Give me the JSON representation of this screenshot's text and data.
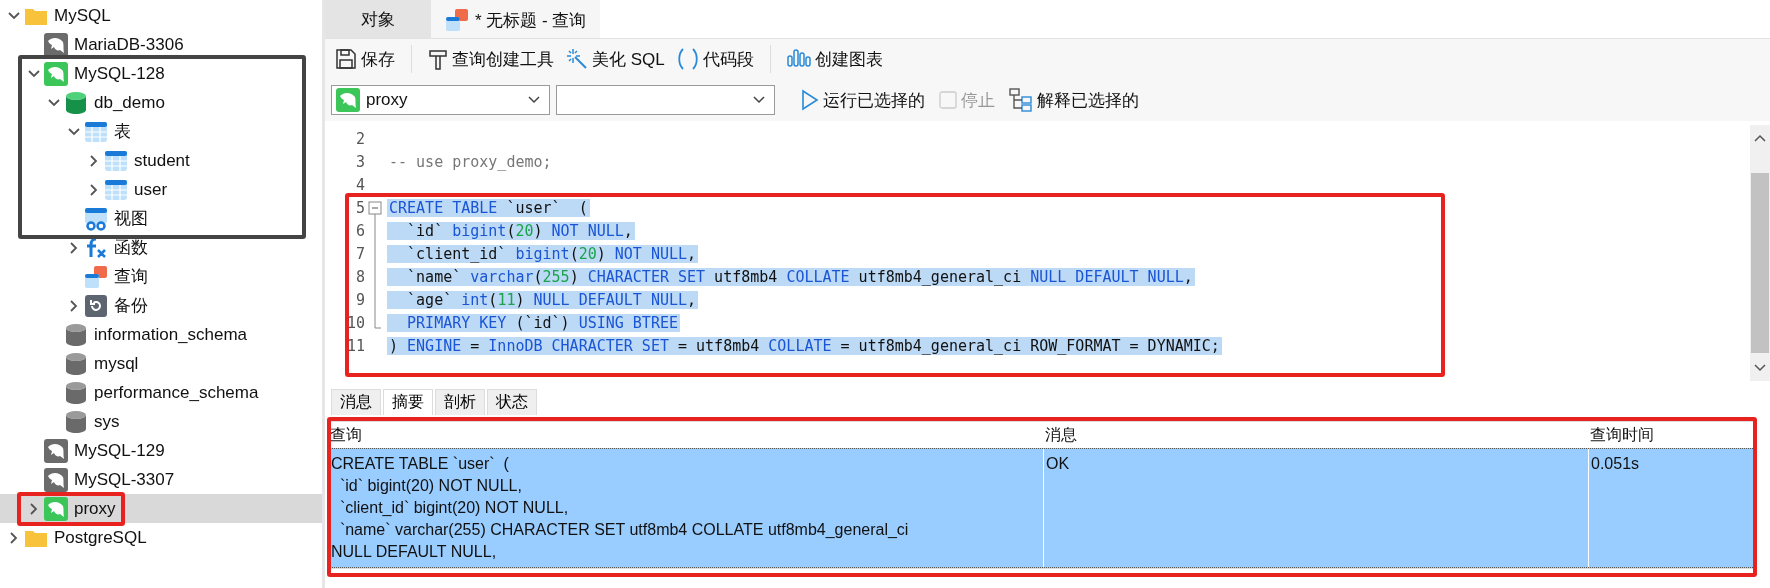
{
  "tree": [
    {
      "label": "MySQL",
      "kind": "folder",
      "expanded": true,
      "selected": false,
      "children": [
        {
          "label": "MariaDB-3306",
          "kind": "connection",
          "connected": false,
          "selected": false
        },
        {
          "label": "MySQL-128",
          "kind": "connection",
          "connected": true,
          "expanded": true,
          "selected": false,
          "children": [
            {
              "label": "db_demo",
              "kind": "database",
              "open": true,
              "expanded": true,
              "selected": false,
              "children": [
                {
                  "label": "表",
                  "kind": "tables",
                  "expanded": true,
                  "selected": false,
                  "children": [
                    {
                      "label": "student",
                      "kind": "table",
                      "expanded": false,
                      "selected": false
                    },
                    {
                      "label": "user",
                      "kind": "table",
                      "expanded": false,
                      "selected": false
                    }
                  ]
                },
                {
                  "label": "视图",
                  "kind": "views",
                  "selected": false
                },
                {
                  "label": "函数",
                  "kind": "functions",
                  "expanded": false,
                  "selected": false
                },
                {
                  "label": "查询",
                  "kind": "queries",
                  "selected": false
                },
                {
                  "label": "备份",
                  "kind": "backups",
                  "expanded": false,
                  "selected": false
                }
              ]
            },
            {
              "label": "information_schema",
              "kind": "database",
              "open": false,
              "selected": false
            },
            {
              "label": "mysql",
              "kind": "database",
              "open": false,
              "selected": false
            },
            {
              "label": "performance_schema",
              "kind": "database",
              "open": false,
              "selected": false
            },
            {
              "label": "sys",
              "kind": "database",
              "open": false,
              "selected": false
            }
          ]
        },
        {
          "label": "MySQL-129",
          "kind": "connection",
          "connected": false,
          "selected": false
        },
        {
          "label": "MySQL-3307",
          "kind": "connection",
          "connected": false,
          "selected": false
        },
        {
          "label": "proxy",
          "kind": "connection",
          "connected": true,
          "expanded": false,
          "selected": true
        }
      ]
    },
    {
      "label": "PostgreSQL",
      "kind": "folder",
      "expanded": false,
      "selected": false
    }
  ],
  "tabs": [
    {
      "label": "对象",
      "kind": "plain",
      "selected": false
    },
    {
      "label": "* 无标题 - 查询",
      "kind": "query",
      "selected": true
    }
  ],
  "toolbar": [
    {
      "label": "保存",
      "kind": "save"
    },
    {
      "kind": "separator"
    },
    {
      "label": "查询创建工具",
      "kind": "builder"
    },
    {
      "label": "美化 SQL",
      "kind": "beautify"
    },
    {
      "label": "代码段",
      "kind": "snippet"
    },
    {
      "kind": "separator"
    },
    {
      "label": "创建图表",
      "kind": "chart"
    }
  ],
  "connection_select": {
    "value": "proxy"
  },
  "actions": [
    {
      "label": "运行已选择的",
      "kind": "run",
      "disabled": false
    },
    {
      "label": "停止",
      "kind": "stop",
      "disabled": true
    },
    {
      "label": "解释已选择的",
      "kind": "explain",
      "disabled": false
    }
  ],
  "editor": {
    "lines": [
      {
        "number": "2",
        "selected": false
      },
      {
        "number": "3",
        "selected": false,
        "tokens": [
          {
            "text": "-- use proxy_demo;",
            "kind": "comment"
          }
        ]
      },
      {
        "number": "4",
        "selected": false
      },
      {
        "number": "5",
        "selected": true,
        "fold_collapsed": false,
        "tokens": [
          {
            "text": "CREATE TABLE",
            "kind": "keyword"
          },
          {
            "text": " `user`  (",
            "kind": "plain"
          }
        ]
      },
      {
        "number": "6",
        "selected": true,
        "tokens": [
          {
            "text": "  `id` ",
            "kind": "plain"
          },
          {
            "text": "bigint",
            "kind": "keyword"
          },
          {
            "text": "(",
            "kind": "plain"
          },
          {
            "text": "20",
            "kind": "number"
          },
          {
            "text": ") ",
            "kind": "plain"
          },
          {
            "text": "NOT NULL",
            "kind": "keyword"
          },
          {
            "text": ",",
            "kind": "plain"
          }
        ]
      },
      {
        "number": "7",
        "selected": true,
        "tokens": [
          {
            "text": "  `client_id` ",
            "kind": "plain"
          },
          {
            "text": "bigint",
            "kind": "keyword"
          },
          {
            "text": "(",
            "kind": "plain"
          },
          {
            "text": "20",
            "kind": "number"
          },
          {
            "text": ") ",
            "kind": "plain"
          },
          {
            "text": "NOT NULL",
            "kind": "keyword"
          },
          {
            "text": ",",
            "kind": "plain"
          }
        ]
      },
      {
        "number": "8",
        "selected": true,
        "tokens": [
          {
            "text": "  `name` ",
            "kind": "plain"
          },
          {
            "text": "varchar",
            "kind": "keyword"
          },
          {
            "text": "(",
            "kind": "plain"
          },
          {
            "text": "255",
            "kind": "number"
          },
          {
            "text": ") ",
            "kind": "plain"
          },
          {
            "text": "CHARACTER SET",
            "kind": "keyword"
          },
          {
            "text": " utf8mb4 ",
            "kind": "plain"
          },
          {
            "text": "COLLATE",
            "kind": "keyword"
          },
          {
            "text": " utf8mb4_general_ci ",
            "kind": "plain"
          },
          {
            "text": "NULL DEFAULT NULL",
            "kind": "keyword"
          },
          {
            "text": ",",
            "kind": "plain"
          }
        ]
      },
      {
        "number": "9",
        "selected": true,
        "tokens": [
          {
            "text": "  `age` ",
            "kind": "plain"
          },
          {
            "text": "int",
            "kind": "keyword"
          },
          {
            "text": "(",
            "kind": "plain"
          },
          {
            "text": "11",
            "kind": "number"
          },
          {
            "text": ") ",
            "kind": "plain"
          },
          {
            "text": "NULL DEFAULT NULL",
            "kind": "keyword"
          },
          {
            "text": ",",
            "kind": "plain"
          }
        ]
      },
      {
        "number": "10",
        "selected": true,
        "tokens": [
          {
            "text": "  PRIMARY KEY",
            "kind": "keyword"
          },
          {
            "text": " (`id`) ",
            "kind": "plain"
          },
          {
            "text": "USING BTREE",
            "kind": "keyword"
          }
        ]
      },
      {
        "number": "11",
        "selected": true,
        "tokens": [
          {
            "text": ") ",
            "kind": "plain"
          },
          {
            "text": "ENGINE",
            "kind": "keyword"
          },
          {
            "text": " = ",
            "kind": "plain"
          },
          {
            "text": "InnoDB CHARACTER SET",
            "kind": "keyword"
          },
          {
            "text": " = utf8mb4 ",
            "kind": "plain"
          },
          {
            "text": "COLLATE",
            "kind": "keyword"
          },
          {
            "text": " = utf8mb4_general_ci ROW_FORMAT = DYNAMIC;",
            "kind": "plain"
          }
        ]
      }
    ]
  },
  "result_tabs": [
    {
      "label": "消息",
      "selected": false
    },
    {
      "label": "摘要",
      "selected": true
    },
    {
      "label": "剖析",
      "selected": false
    },
    {
      "label": "状态",
      "selected": false
    }
  ],
  "result_table": {
    "columns": [
      "查询",
      "消息",
      "查询时间"
    ],
    "rows": [
      {
        "selected": true,
        "query_lines": [
          "CREATE TABLE `user`  (",
          "  `id` bigint(20) NOT NULL,",
          "  `client_id` bigint(20) NOT NULL,",
          "  `name` varchar(255) CHARACTER SET utf8mb4 COLLATE utf8mb4_general_ci",
          "NULL DEFAULT NULL,"
        ],
        "message": "OK",
        "time": "0.051s"
      }
    ]
  }
}
